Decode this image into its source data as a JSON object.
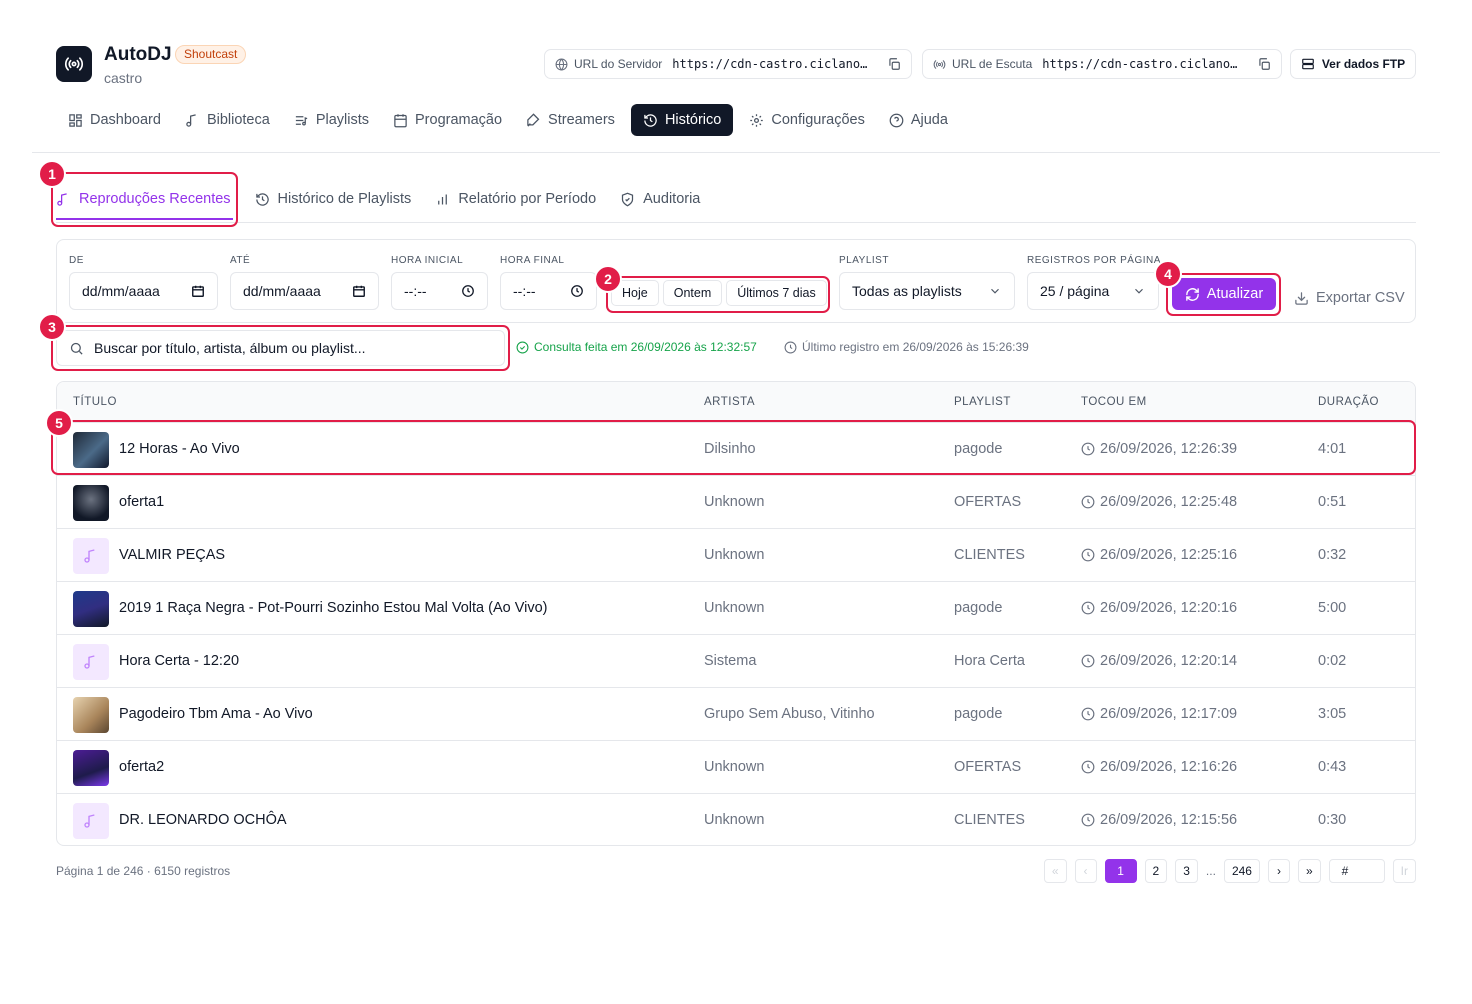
{
  "app": {
    "title": "AutoDJ",
    "badge": "Shoutcast",
    "subtitle": "castro"
  },
  "header": {
    "server_url_label": "URL do Servidor",
    "server_url_value": "https://cdn-castro.ciclano…",
    "listen_url_label": "URL de Escuta",
    "listen_url_value": "https://cdn-castro.ciclano…",
    "ftp_button": "Ver dados FTP"
  },
  "nav": {
    "items": [
      {
        "label": "Dashboard",
        "icon": "dashboard-icon"
      },
      {
        "label": "Biblioteca",
        "icon": "music-note-icon"
      },
      {
        "label": "Playlists",
        "icon": "playlist-icon"
      },
      {
        "label": "Programação",
        "icon": "calendar-icon"
      },
      {
        "label": "Streamers",
        "icon": "microphone-icon"
      },
      {
        "label": "Histórico",
        "icon": "history-icon",
        "active": true
      },
      {
        "label": "Configurações",
        "icon": "gear-icon"
      },
      {
        "label": "Ajuda",
        "icon": "help-icon"
      }
    ]
  },
  "subtabs": [
    {
      "label": "Reproduções Recentes",
      "active": true
    },
    {
      "label": "Histórico de Playlists"
    },
    {
      "label": "Relatório por Período"
    },
    {
      "label": "Auditoria"
    }
  ],
  "filters": {
    "from_label": "DE",
    "from_value": "dd/mm/aaaa",
    "to_label": "ATÉ",
    "to_value": "dd/mm/aaaa",
    "start_time_label": "HORA INICIAL",
    "start_time_value": "--:--",
    "end_time_label": "HORA FINAL",
    "end_time_value": "--:--",
    "quick": [
      "Hoje",
      "Ontem",
      "Últimos 7 dias"
    ],
    "playlist_label": "PLAYLIST",
    "playlist_value": "Todas as playlists",
    "per_page_label": "REGISTROS POR PÁGINA",
    "per_page_value": "25 / página",
    "refresh_button": "Atualizar",
    "export_button": "Exportar CSV"
  },
  "search": {
    "placeholder": "Buscar por título, artista, álbum ou playlist..."
  },
  "status": {
    "query": "Consulta feita em 26/09/2026 às 12:32:57",
    "last_record": "Último registro em 26/09/2026 às 15:26:39"
  },
  "table": {
    "headers": [
      "TÍTULO",
      "ARTISTA",
      "PLAYLIST",
      "TOCOU EM",
      "DURAÇÃO"
    ],
    "rows": [
      {
        "title": "12 Horas - Ao Vivo",
        "artist": "Dilsinho",
        "playlist": "pagode",
        "played_at": "26/09/2026, 12:26:39",
        "duration": "4:01",
        "thumb": "cover"
      },
      {
        "title": "oferta1",
        "artist": "Unknown",
        "playlist": "OFERTAS",
        "played_at": "26/09/2026, 12:25:48",
        "duration": "0:51",
        "thumb": "cover"
      },
      {
        "title": "VALMIR PEÇAS",
        "artist": "Unknown",
        "playlist": "CLIENTES",
        "played_at": "26/09/2026, 12:25:16",
        "duration": "0:32",
        "thumb": "placeholder"
      },
      {
        "title": "2019 1 Raça Negra - Pot-Pourri Sozinho Estou Mal Volta (Ao Vivo)",
        "artist": "Unknown",
        "playlist": "pagode",
        "played_at": "26/09/2026, 12:20:16",
        "duration": "5:00",
        "thumb": "cover"
      },
      {
        "title": "Hora Certa - 12:20",
        "artist": "Sistema",
        "playlist": "Hora Certa",
        "played_at": "26/09/2026, 12:20:14",
        "duration": "0:02",
        "thumb": "placeholder"
      },
      {
        "title": "Pagodeiro Tbm Ama - Ao Vivo",
        "artist": "Grupo Sem Abuso, Vitinho",
        "playlist": "pagode",
        "played_at": "26/09/2026, 12:17:09",
        "duration": "3:05",
        "thumb": "cover"
      },
      {
        "title": "oferta2",
        "artist": "Unknown",
        "playlist": "OFERTAS",
        "played_at": "26/09/2026, 12:16:26",
        "duration": "0:43",
        "thumb": "cover"
      },
      {
        "title": "DR. LEONARDO OCHÔA",
        "artist": "Unknown",
        "playlist": "CLIENTES",
        "played_at": "26/09/2026, 12:15:56",
        "duration": "0:30",
        "thumb": "placeholder"
      }
    ]
  },
  "pagination": {
    "info": "Página 1 de 246 · 6150 registros",
    "first": "«",
    "prev": "‹",
    "pages": [
      "1",
      "2",
      "3"
    ],
    "ellipsis": "...",
    "last_page": "246",
    "next": "›",
    "last": "»",
    "jump_placeholder": "#",
    "go": "Ir"
  },
  "annotations": [
    "1",
    "2",
    "3",
    "4",
    "5"
  ],
  "colors": {
    "accent": "#9333ea",
    "highlight": "#e11d48",
    "dark": "#111827"
  }
}
